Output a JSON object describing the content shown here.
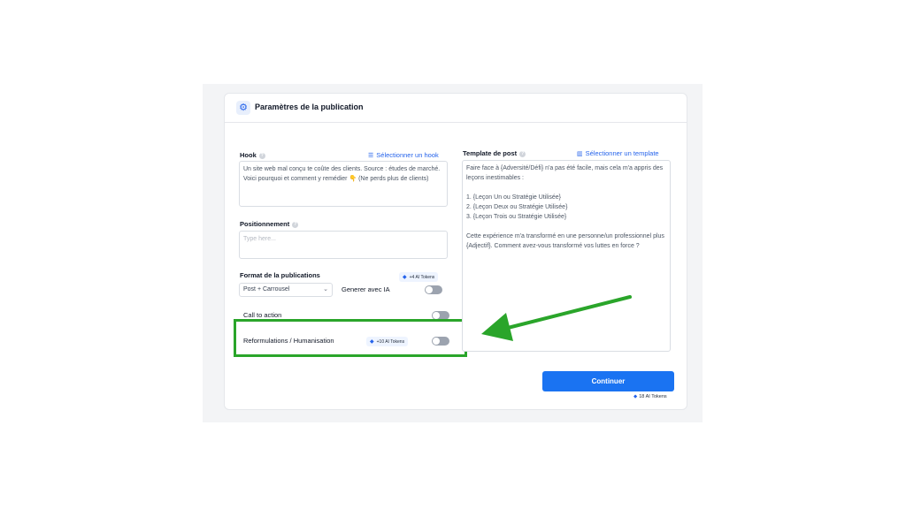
{
  "header": {
    "title": "Paramètres de la publication",
    "icon": "gear-icon"
  },
  "hook": {
    "label": "Hook",
    "select_link": "Sélectionner un hook",
    "value": "Un site web mal conçu te coûte des clients. Source : études de marché. Voici pourquoi et comment y remédier 👇 (Ne perds plus de clients)"
  },
  "positionnement": {
    "label": "Positionnement",
    "placeholder": "Type here..."
  },
  "format": {
    "label": "Format de la publications",
    "selected": "Post + Carrousel",
    "ai_label": "Generer avec IA",
    "ai_tokens": "+4 AI Tokens",
    "ai_enabled": false
  },
  "cta": {
    "label": "Call to action",
    "enabled": false
  },
  "reformulations": {
    "label": "Reformulations / Humanisation",
    "tokens": "+10 AI Tokens",
    "enabled": false
  },
  "template": {
    "label": "Template de post",
    "select_link": "Sélectionner un template",
    "value": "Faire face à {Adversité/Défi} n'a pas été facile, mais cela m'a appris des leçons inestimables :\n\n1. {Leçon Un ou Stratégie Utilisée}\n2. {Leçon Deux ou Stratégie Utilisée}\n3. {Leçon Trois ou Stratégie Utilisée}\n\nCette expérience m'a transformé en une personne/un professionnel plus {Adjectif}. Comment avez-vous transformé vos luttes en force ?"
  },
  "actions": {
    "continue_label": "Continuer",
    "total_tokens": "18 AI Tokens"
  },
  "colors": {
    "accent": "#1a73f2",
    "highlight": "#2aa52a"
  }
}
